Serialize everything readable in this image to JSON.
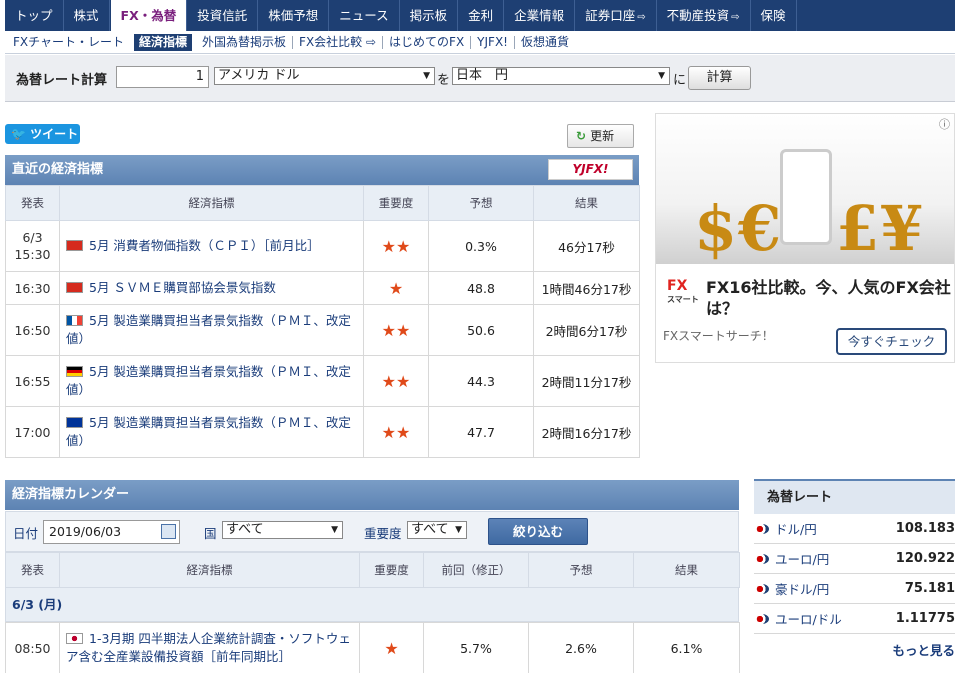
{
  "nav": {
    "items": [
      {
        "label": "トップ",
        "ext": ""
      },
      {
        "label": "株式",
        "ext": ""
      },
      {
        "label": "FX・為替",
        "ext": ""
      },
      {
        "label": "投資信託",
        "ext": ""
      },
      {
        "label": "株価予想",
        "ext": ""
      },
      {
        "label": "ニュース",
        "ext": ""
      },
      {
        "label": "掲示板",
        "ext": ""
      },
      {
        "label": "金利",
        "ext": ""
      },
      {
        "label": "企業情報",
        "ext": ""
      },
      {
        "label": "証券口座",
        "ext": "⇨"
      },
      {
        "label": "不動産投資",
        "ext": "⇨"
      },
      {
        "label": "保険",
        "ext": ""
      }
    ]
  },
  "subnav": {
    "items": [
      {
        "label": "FXチャート・レート"
      },
      {
        "label": "経済指標"
      },
      {
        "label": "外国為替掲示板"
      },
      {
        "label": "FX会社比較 ⇨"
      },
      {
        "label": "はじめてのFX"
      },
      {
        "label": "YJFX!"
      },
      {
        "label": "仮想通貨"
      }
    ]
  },
  "calc": {
    "label": "為替レート計算",
    "amount": "1",
    "from": "アメリカ ドル",
    "wo": "を",
    "to": "日本　円",
    "ni": "に",
    "button": "計算"
  },
  "tweet": "ツイート",
  "refresh": "更新",
  "indicators": {
    "title": "直近の経済指標",
    "sponsor": "YJFX!",
    "headers": [
      "発表",
      "経済指標",
      "重要度",
      "予想",
      "結果"
    ],
    "rows": [
      {
        "time": "6/3\n15:30",
        "flag": "ch",
        "name": "5月 消費者物価指数（ＣＰＩ）［前月比］",
        "stars": "★★",
        "forecast": "0.3%",
        "result": "46分17秒"
      },
      {
        "time": "16:30",
        "flag": "ch",
        "name": "5月 ＳＶＭＥ購買部協会景気指数",
        "stars": "★",
        "forecast": "48.8",
        "result": "1時間46分17秒"
      },
      {
        "time": "16:50",
        "flag": "fr",
        "name": "5月 製造業購買担当者景気指数（ＰＭＩ、改定値）",
        "stars": "★★",
        "forecast": "50.6",
        "result": "2時間6分17秒"
      },
      {
        "time": "16:55",
        "flag": "de",
        "name": "5月 製造業購買担当者景気指数（ＰＭＩ、改定値）",
        "stars": "★★",
        "forecast": "44.3",
        "result": "2時間11分17秒"
      },
      {
        "time": "17:00",
        "flag": "eu",
        "name": "5月 製造業購買担当者景気指数（ＰＭＩ、改定値）",
        "stars": "★★",
        "forecast": "47.7",
        "result": "2時間16分17秒"
      }
    ]
  },
  "ad": {
    "info": "ⓘ",
    "logo": "FX",
    "logo_sub": "スマート",
    "title": "FX16社比較。今、人気のFX会社は？",
    "source": "FXスマートサーチ！",
    "button": "今すぐチェック"
  },
  "calendar": {
    "title": "経済指標カレンダー",
    "date_label": "日付",
    "date": "2019/06/03",
    "country_label": "国",
    "country": "すべて",
    "importance_label": "重要度",
    "importance": "すべて",
    "button": "絞り込む",
    "headers": [
      "発表",
      "経済指標",
      "重要度",
      "前回（修正）",
      "予想",
      "結果"
    ],
    "day": "6/3 (月)",
    "rows": [
      {
        "time": "08:50",
        "flag": "jp",
        "name": "1-3月期 四半期法人企業統計調査・ソフトウェア含む全産業設備投資額［前年同期比］",
        "stars": "★",
        "previous": "5.7%",
        "forecast": "2.6%",
        "result": "6.1%"
      }
    ]
  },
  "rates": {
    "title": "為替レート",
    "items": [
      {
        "name": "ドル/円",
        "value": "108.183"
      },
      {
        "name": "ユーロ/円",
        "value": "120.922"
      },
      {
        "name": "豪ドル/円",
        "value": "75.181"
      },
      {
        "name": "ユーロ/ドル",
        "value": "1.11775"
      }
    ],
    "more": "もっと見る"
  }
}
